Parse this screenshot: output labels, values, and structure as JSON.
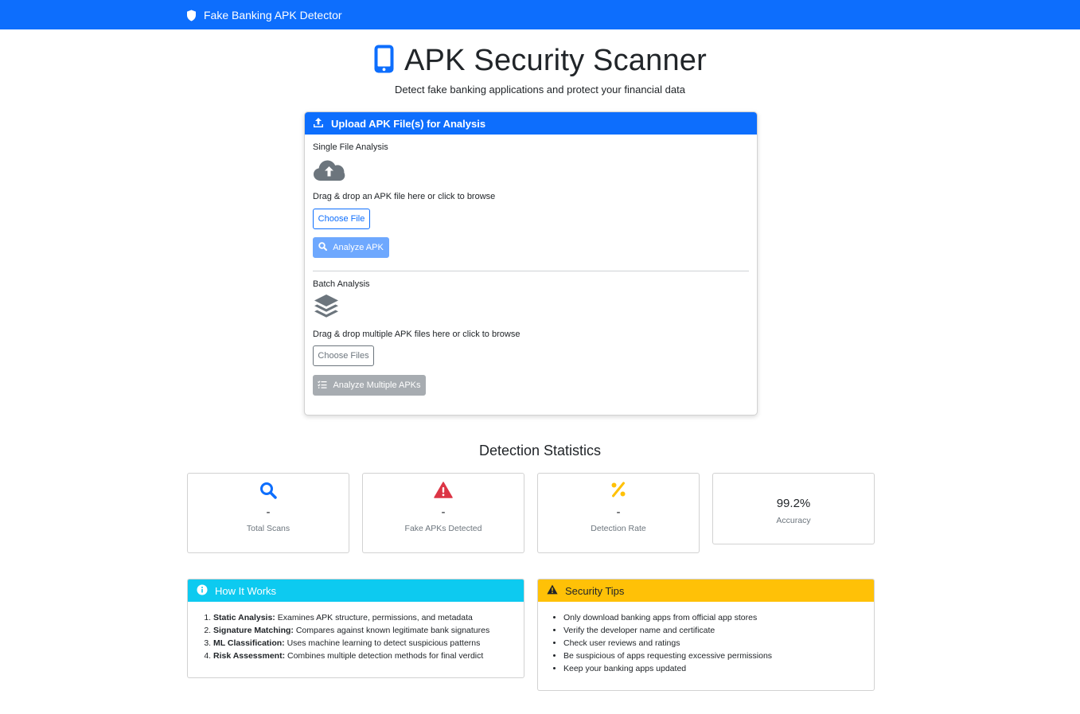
{
  "navbar": {
    "brand": "Fake Banking APK Detector",
    "brand_icon": "shield-icon",
    "color": "#0d6efd"
  },
  "hero": {
    "title": "APK Security Scanner",
    "title_icon": "mobile-phone-icon",
    "subtitle": "Detect fake banking applications and protect your financial data"
  },
  "upload": {
    "header": "Upload APK File(s) for Analysis",
    "header_icon": "upload-icon",
    "single": {
      "label": "Single File Analysis",
      "icon": "cloud-upload-icon",
      "dropzone_text": "Drag & drop an APK file here or click to browse",
      "choose_label": "Choose File",
      "analyze_label": "Analyze APK",
      "analyze_icon": "search-icon"
    },
    "batch": {
      "label": "Batch Analysis",
      "icon": "layers-icon",
      "dropzone_text": "Drag & drop multiple APK files here or click to browse",
      "choose_label": "Choose Files",
      "analyze_label": "Analyze Multiple APKs",
      "analyze_icon": "list-check-icon"
    }
  },
  "stats": {
    "title": "Detection Statistics",
    "cards": [
      {
        "icon": "search-icon",
        "value": "-",
        "label": "Total Scans",
        "color": "#0d6efd"
      },
      {
        "icon": "warning-triangle-icon",
        "value": "-",
        "label": "Fake APKs Detected",
        "color": "#dc3545"
      },
      {
        "icon": "percent-icon",
        "value": "-",
        "label": "Detection Rate",
        "color": "#ffc107"
      },
      {
        "icon": "",
        "value": "99.2%",
        "label": "Accuracy",
        "color": "#212529"
      }
    ]
  },
  "how_it_works": {
    "title": "How It Works",
    "icon": "info-circle-icon",
    "color": "#0dcaf0",
    "items": [
      {
        "term": "Static Analysis:",
        "text": " Examines APK structure, permissions, and metadata"
      },
      {
        "term": "Signature Matching:",
        "text": " Compares against known legitimate bank signatures"
      },
      {
        "term": "ML Classification:",
        "text": " Uses machine learning to detect suspicious patterns"
      },
      {
        "term": "Risk Assessment:",
        "text": " Combines multiple detection methods for final verdict"
      }
    ]
  },
  "security_tips": {
    "title": "Security Tips",
    "icon": "warning-triangle-icon",
    "color": "#ffc107",
    "items": [
      "Only download banking apps from official app stores",
      "Verify the developer name and certificate",
      "Check user reviews and ratings",
      "Be suspicious of apps requesting excessive permissions",
      "Keep your banking apps updated"
    ]
  }
}
